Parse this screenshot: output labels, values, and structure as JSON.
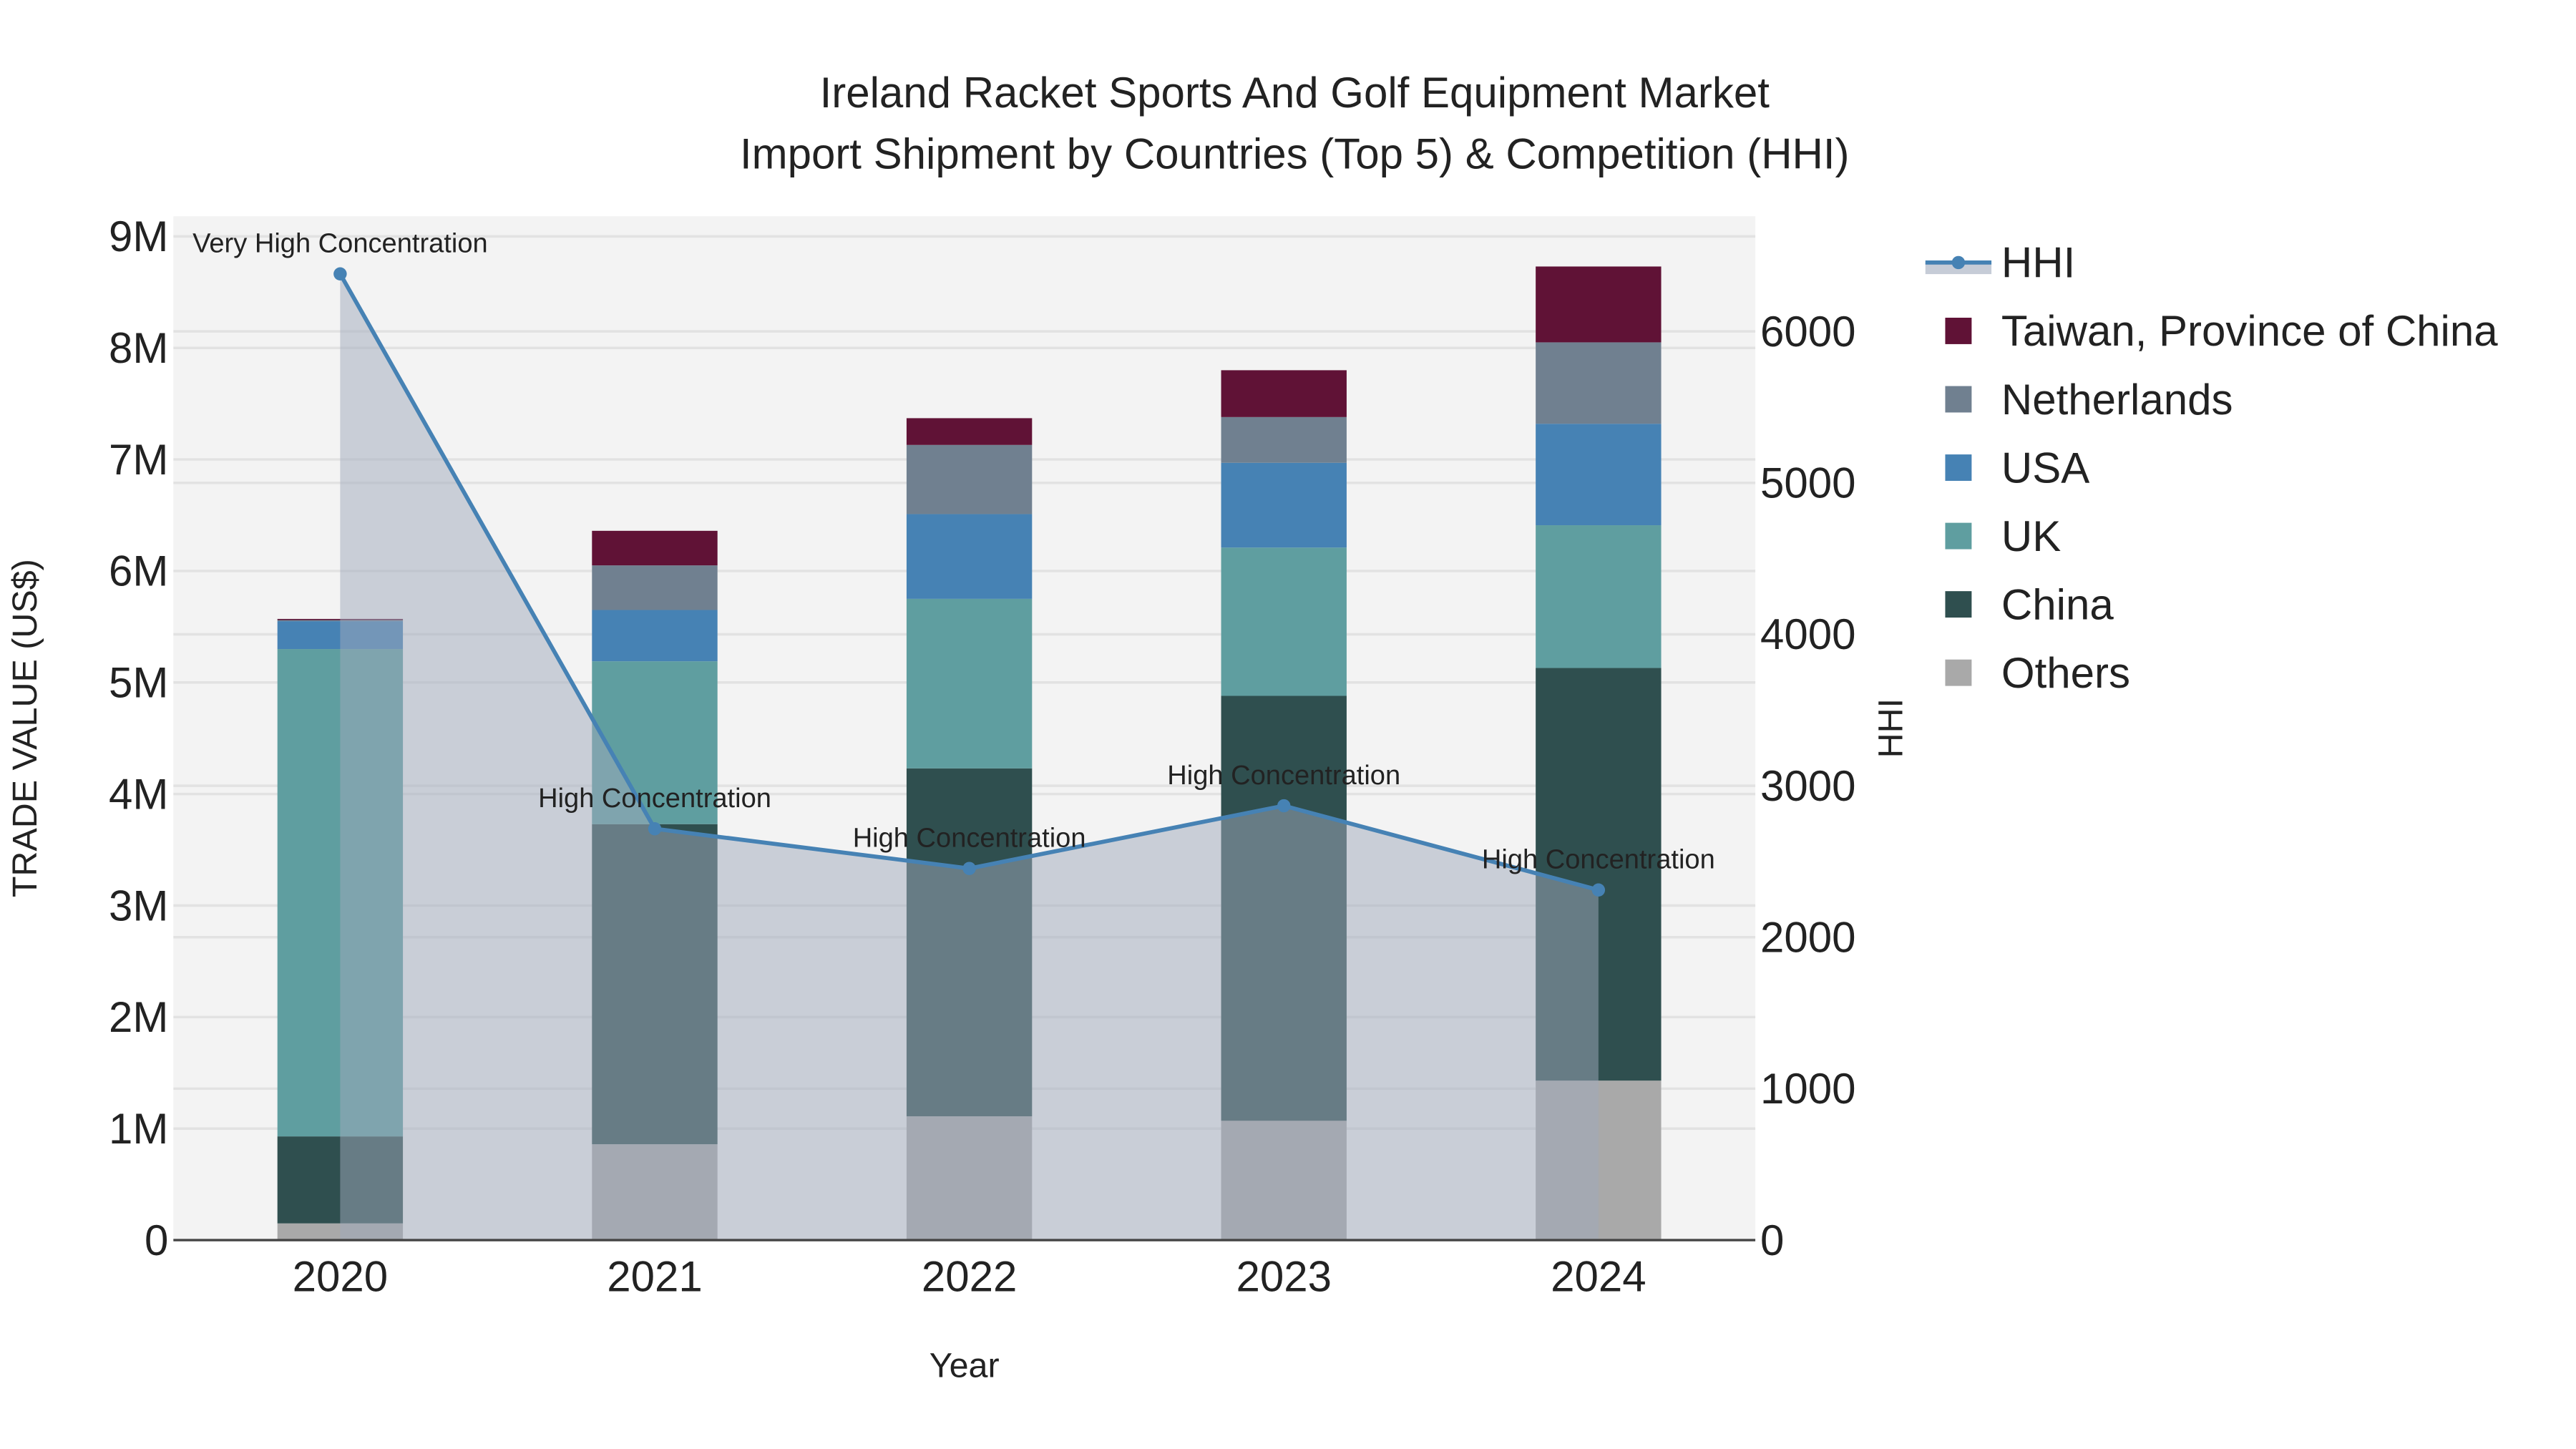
{
  "chart_data": {
    "type": "bar",
    "stacked": true,
    "title": "Ireland Racket Sports And Golf Equipment Market",
    "subtitle": "Import Shipment by Countries (Top 5) & Competition (HHI)",
    "xlabel": "Year",
    "ylabel": "TRADE VALUE (US$)",
    "y2label": "HHI",
    "categories": [
      "2020",
      "2021",
      "2022",
      "2023",
      "2024"
    ],
    "ylim": [
      0,
      9180000
    ],
    "y2lim": [
      0,
      6760
    ],
    "yticks": [
      0,
      1000000,
      2000000,
      3000000,
      4000000,
      5000000,
      6000000,
      7000000,
      8000000,
      9000000
    ],
    "ytick_labels": [
      "0",
      "1M",
      "2M",
      "3M",
      "4M",
      "5M",
      "6M",
      "7M",
      "8M",
      "9M"
    ],
    "y2ticks": [
      0,
      1000,
      2000,
      3000,
      4000,
      5000,
      6000
    ],
    "y2tick_labels": [
      "0",
      "1000",
      "2000",
      "3000",
      "4000",
      "5000",
      "6000"
    ],
    "grid": true,
    "legend_placement": "right",
    "series": [
      {
        "name": "Others",
        "color": "#a9a9a9",
        "values": [
          150000,
          860000,
          1110000,
          1070000,
          1430000
        ]
      },
      {
        "name": "China",
        "color": "#2f4f4f",
        "values": [
          780000,
          2870000,
          3120000,
          3810000,
          3700000
        ]
      },
      {
        "name": "UK",
        "color": "#5f9ea0",
        "values": [
          4370000,
          1460000,
          1520000,
          1330000,
          1280000
        ]
      },
      {
        "name": "USA",
        "color": "#4682b4",
        "values": [
          250000,
          460000,
          760000,
          760000,
          910000
        ]
      },
      {
        "name": "Netherlands",
        "color": "#708090",
        "values": [
          10000,
          400000,
          620000,
          410000,
          730000
        ]
      },
      {
        "name": "Taiwan, Province of China",
        "color": "#601236",
        "values": [
          10000,
          310000,
          240000,
          420000,
          680000
        ]
      }
    ],
    "hhi": {
      "name": "HHI",
      "color": "#4682b4",
      "values": [
        6380,
        2716,
        2454,
        2868,
        2312
      ],
      "annotations": [
        "Very High Concentration",
        "High Concentration",
        "High Concentration",
        "High Concentration",
        "High Concentration"
      ]
    },
    "legend_order": [
      "HHI",
      "Taiwan, Province of China",
      "Netherlands",
      "USA",
      "UK",
      "China",
      "Others"
    ]
  }
}
